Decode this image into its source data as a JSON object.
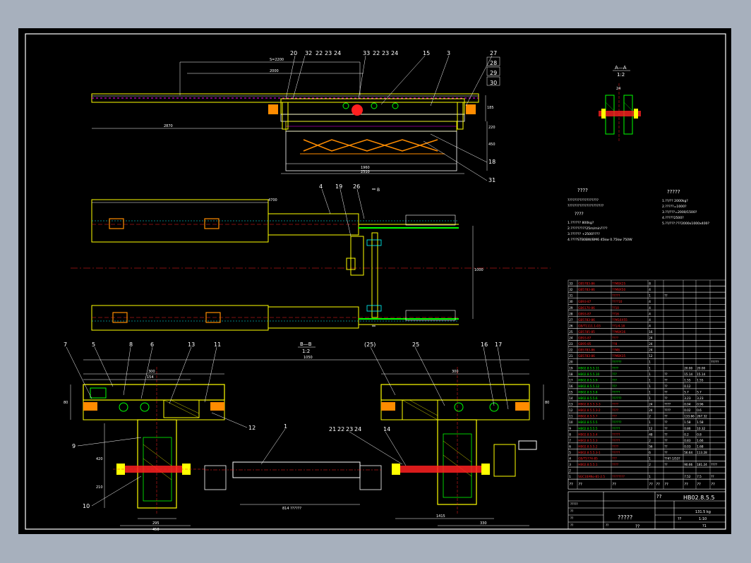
{
  "colors": {
    "background": "#a7b0bd",
    "canvas": "#000000",
    "border": "#ffffff",
    "yellow": "#ffff00",
    "white": "#ffffff",
    "magenta": "#ff00ff",
    "red": "#ff2020",
    "green": "#00ff00",
    "cyan": "#00ffff",
    "blue": "#3030ff",
    "orange": "#ff8c00"
  },
  "top_view": {
    "callouts": [
      "20",
      "32",
      "22",
      "23",
      "24",
      "33",
      "22",
      "23",
      "24",
      "15",
      "3"
    ],
    "right_callouts": [
      "27",
      "28",
      "29",
      "30"
    ],
    "lower_callouts": [
      "18",
      "31"
    ],
    "dims": {
      "top": "S=2200",
      "second": "2000",
      "left": "2870",
      "bottom1": "1960",
      "bottom2": "2310",
      "right1": "185",
      "right2": "220",
      "right3": "450"
    }
  },
  "section_aa": {
    "title": "A—A",
    "scale": "1:2",
    "dim": "24"
  },
  "plan_view": {
    "callouts": [
      "4",
      "19",
      "26"
    ],
    "dim_top": "4700",
    "dim_side": "1000",
    "section_mark": "B"
  },
  "section_bb": {
    "title": "B—B",
    "scale": "1:2"
  },
  "bottom_view": {
    "left_callouts": [
      "7",
      "5",
      "8",
      "6",
      "13",
      "11",
      "12",
      "9",
      "10"
    ],
    "center_callout": "1",
    "right_callouts": [
      "(25)",
      "25",
      "16",
      "17",
      "14",
      "21",
      "22",
      "23",
      "24"
    ],
    "dims": {
      "overall": "1050",
      "left_w": "300",
      "left_inner": "154",
      "right_w": "300",
      "shaft": "814",
      "bottom_left": "295",
      "bottom_mid": "450",
      "bottom_right": "1415",
      "bottom_right2": "330",
      "side_left": "80",
      "side_right": "80",
      "left_h": "420",
      "left_h2": "210"
    },
    "shaft_note": "814 ??????"
  },
  "notes": {
    "heading_left": "????",
    "heading_right": "?????",
    "left_lines": [
      "??????????????????",
      "?????????????????????",
      "????",
      "1.?????? 800kg?",
      "2.?????????25m/min????",
      "3.?????? +2500????",
      "4.????STB0BW/BM6 45kw 0.75kw 750W"
    ],
    "right_lines": [
      "1.??/?? 2000kg?",
      "2.?????=1000?",
      "3.??/???=2000/1500?",
      "4.?????2500?",
      "5.??/???:???2000x1000x400?"
    ]
  },
  "bom": {
    "rows": [
      [
        "33",
        "GB5783-86",
        "??M8X25",
        "8",
        "",
        "",
        "",
        "",
        ""
      ],
      [
        "32",
        "GB5783-86",
        "??M8X50",
        "4",
        "",
        "",
        "",
        "",
        ""
      ],
      [
        "31",
        "",
        "?????",
        "1",
        "",
        "??",
        "",
        "",
        ""
      ],
      [
        "30",
        "GB93-87",
        "????10",
        "4",
        "",
        "",
        "",
        "",
        ""
      ],
      [
        "29",
        "GB6170-86",
        "??10",
        "4",
        "",
        "",
        "",
        "",
        ""
      ],
      [
        "28",
        "GB93-87",
        "??16",
        "4",
        "",
        "",
        "",
        "",
        ""
      ],
      [
        "27",
        "GB5783-86",
        "??M16X55",
        "4",
        "",
        "",
        "",
        "",
        ""
      ],
      [
        "26",
        "GB/T1111.1-03",
        "??1/4-18",
        "4",
        "",
        "",
        "",
        "",
        ""
      ],
      [
        "25",
        "GB5785-85",
        "??M8X16",
        "16",
        "",
        "",
        "",
        "",
        ""
      ],
      [
        "24",
        "GB93-87",
        "????",
        "24",
        "",
        "",
        "",
        "",
        ""
      ],
      [
        "23",
        "GB95-85",
        "??8",
        "24",
        "",
        "",
        "",
        "",
        ""
      ],
      [
        "22",
        "GB5783-86",
        "??M8",
        "24",
        "",
        "",
        "",
        "",
        ""
      ],
      [
        "21",
        "GB5783-86",
        "??M8X35",
        "12",
        "",
        "",
        "",
        "",
        ""
      ],
      [
        "20",
        "",
        "??????",
        "1",
        "",
        "",
        "",
        "",
        "?????"
      ],
      [
        "19",
        "HB02.8.5.5.11",
        "????",
        "1",
        "",
        "",
        "20.00",
        "20.00",
        ""
      ],
      [
        "18",
        "HB02.8.5.5.10",
        "???",
        "1",
        "",
        "??",
        "15.14",
        "15.14",
        ""
      ],
      [
        "17",
        "HB02.8.5.5.9",
        "???",
        "1",
        "",
        "??",
        "1.55",
        "1.55",
        ""
      ],
      [
        "16",
        "HB02.8.5.5.12",
        "???",
        "1",
        "",
        "??",
        "0.12",
        "",
        ""
      ],
      [
        "15",
        "HB02.8.5.5.8",
        "?????",
        "1",
        "",
        "??",
        "5.7",
        "5.7",
        ""
      ],
      [
        "14",
        "HB02.8.5.5.6",
        "??????",
        "1",
        "",
        "??",
        "3.23",
        "3.23",
        ""
      ],
      [
        "13",
        "HB02.8.5.5.3-3",
        "????",
        "24",
        "",
        "????",
        "0.04",
        "0.96",
        ""
      ],
      [
        "12",
        "HB02.8.5.5.3-2",
        "????",
        "24",
        "",
        "????",
        "0.02",
        "0.6",
        ""
      ],
      [
        "11",
        "HB02.8.5.5.7",
        "???",
        "2",
        "",
        "??",
        "133.66",
        "267.32",
        ""
      ],
      [
        "10",
        "HB02.8.5.5.5",
        "??????",
        "1",
        "",
        "??",
        "1.58",
        "1.58",
        ""
      ],
      [
        "9",
        "HB02.8.5.5.5",
        "?????",
        "12",
        "",
        "??",
        "0.86",
        "10.32",
        ""
      ],
      [
        "8",
        "HB02.8.5.5.4",
        "?????",
        "48",
        "",
        "??",
        "0.2",
        "0.8",
        ""
      ],
      [
        "7",
        "HB02.8.5.5.3",
        "?????",
        "2",
        "",
        "??",
        "0.83",
        "1.66",
        ""
      ],
      [
        "6",
        "HB02.8.5.5.2",
        "????",
        "56",
        "",
        "??",
        "0.03",
        "1.68",
        ""
      ],
      [
        "5",
        "HB02.8.5.5.3-1",
        "?????",
        "6",
        "",
        "??",
        "56.64",
        "113.28",
        ""
      ],
      [
        "4",
        "GB/T5774-85",
        "???",
        "1",
        "",
        "??4?-1/53?",
        "",
        "",
        ""
      ],
      [
        "3",
        "HB02.8.5.5.1",
        "????",
        "2",
        "",
        "??",
        "90.66",
        "181.24",
        "????"
      ],
      [
        "2",
        "",
        "",
        "",
        "",
        "",
        "",
        "",
        ""
      ],
      [
        "1",
        "SGC10ANo-81-2.5",
        "????????",
        "1",
        "",
        "",
        "7.52",
        "7.5",
        "??"
      ]
    ],
    "header": [
      "??",
      "??",
      "??",
      "??",
      "??",
      "??",
      "??",
      "??",
      "??"
    ],
    "title_code": "HB02.8.5.5",
    "title_name": "?????",
    "scale_label": "??",
    "scale_value": "1:10",
    "weight": "131.5 kg",
    "sheet": "?1",
    "mark": "??",
    "company": "??",
    "row_labels": [
      "?????",
      "??",
      "??",
      "??",
      "??"
    ]
  }
}
